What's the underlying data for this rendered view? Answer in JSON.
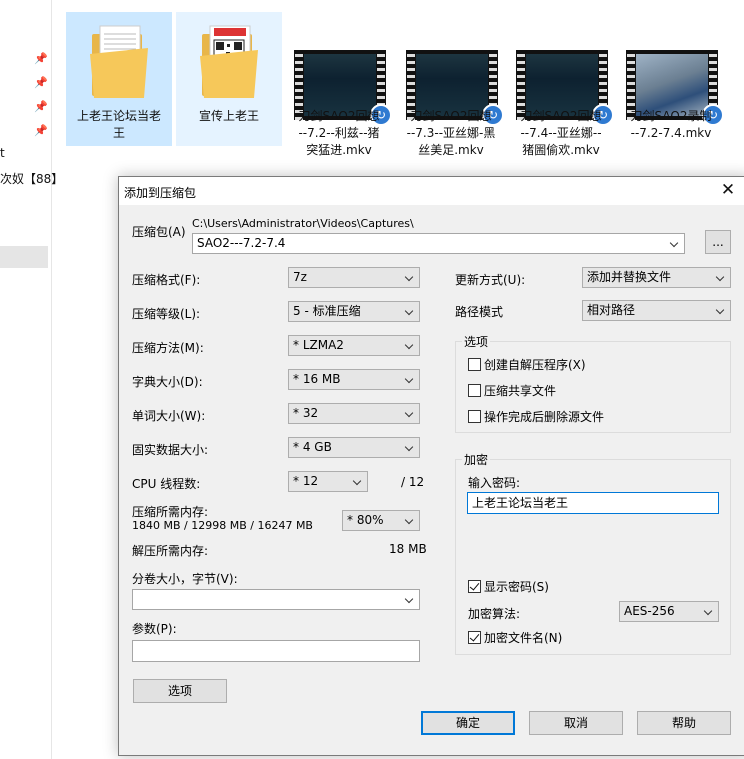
{
  "explorer": {
    "left_text_1": "t",
    "left_text_2": "次奴【88】",
    "files": [
      {
        "name": "上老王论坛当老王",
        "type": "folder"
      },
      {
        "name": "宣传上老王",
        "type": "folder"
      },
      {
        "name": "刀剑SAO2回想--7.2--利兹--猪突猛进.mkv",
        "type": "video"
      },
      {
        "name": "刀剑SAO2回想--7.3--亚丝娜-黑丝美足.mkv",
        "type": "video"
      },
      {
        "name": "刀剑SAO2回想--7.4--亚丝娜--猪圌偷欢.mkv",
        "type": "video"
      },
      {
        "name": "刀剑SAO2录制--7.2-7.4.mkv",
        "type": "video"
      }
    ],
    "labels_display": {
      "f0": "上老王论坛当老\n王",
      "f1": "宣传上老王",
      "f2": "刀剑SAO2回想\n--7.2--利兹--猪\n突猛进.mkv",
      "f3": "刀剑SAO2回想\n--7.3--亚丝娜-黑\n丝美足.mkv",
      "f4": "刀剑SAO2回想\n--7.4--亚丝娜--\n猪圌偷欢.mkv",
      "f5": "刀剑SAO2录制\n--7.2-7.4.mkv"
    },
    "folder_color": "#f6c85a",
    "selection_color": "#cce8ff"
  },
  "dialog": {
    "title": "添加到压缩包",
    "archive_label": "压缩包(A)",
    "archive_path": "C:\\Users\\Administrator\\Videos\\Captures\\",
    "archive_name": "SAO2---7.2-7.4",
    "browse_label": "...",
    "format_label": "压缩格式(F):",
    "format_value": "7z",
    "level_label": "压缩等级(L):",
    "level_value": "5 - 标准压缩",
    "method_label": "压缩方法(M):",
    "method_value": "* LZMA2",
    "dict_label": "字典大小(D):",
    "dict_value": "* 16 MB",
    "word_label": "单词大小(W):",
    "word_value": "* 32",
    "solid_label": "固实数据大小:",
    "solid_value": "* 4 GB",
    "cpu_label": "CPU 线程数:",
    "cpu_value": "* 12",
    "cpu_total": "/ 12",
    "mem_label": "压缩所需内存:",
    "mem_values": "1840 MB / 12998 MB / 16247 MB",
    "mem_percent": "* 80%",
    "decomp_label": "解压所需内存:",
    "decomp_value": "18 MB",
    "split_label": "分卷大小，字节(V):",
    "split_value": "",
    "params_label": "参数(P):",
    "params_value": "",
    "options_button": "选项",
    "update_label": "更新方式(U):",
    "update_value": "添加并替换文件",
    "path_label": "路径模式",
    "path_value": "相对路径",
    "options_group": "选项",
    "opt_sfx": "创建自解压程序(X)",
    "opt_shared": "压缩共享文件",
    "opt_delete": "操作完成后删除源文件",
    "encrypt_group": "加密",
    "password_label": "输入密码:",
    "password_value": "上老王论坛当老王",
    "show_password": "显示密码(S)",
    "enc_method_label": "加密算法:",
    "enc_method_value": "AES-256",
    "encrypt_names": "加密文件名(N)",
    "ok": "确定",
    "cancel": "取消",
    "help": "帮助"
  }
}
